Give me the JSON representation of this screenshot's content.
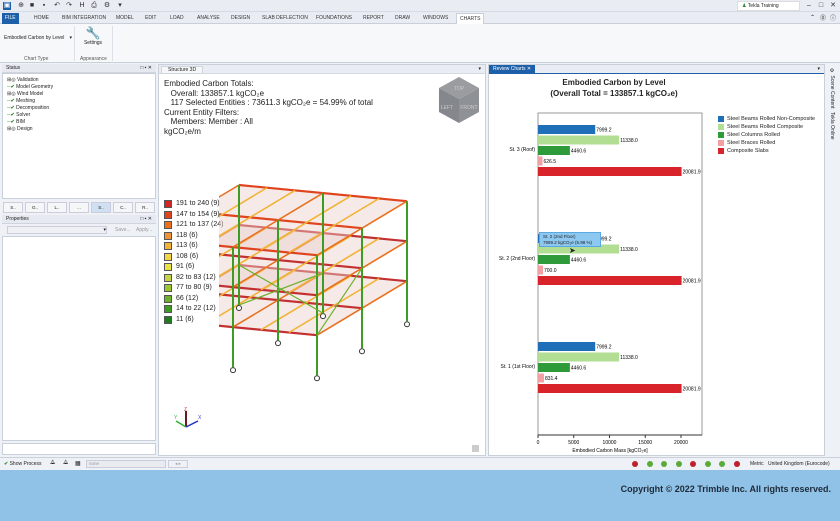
{
  "app": {
    "user": "Tekla Training"
  },
  "ribbon": {
    "tabs": [
      "FILE",
      "HOME",
      "BIM INTEGRATION",
      "MODEL",
      "EDIT",
      "LOAD",
      "ANALYSE",
      "DESIGN",
      "SLAB DEFLECTION",
      "FOUNDATIONS",
      "REPORT",
      "DRAW",
      "WINDOWS",
      "CHARTS"
    ],
    "chart_type_value": "Embodied Carbon by Level",
    "chart_type_group": "Chart Type",
    "settings_label": "Settings",
    "appearance_group": "Appearance"
  },
  "status_panel": {
    "title": "Status",
    "items": [
      {
        "label": "Validation",
        "state": "info"
      },
      {
        "label": "Model Geometry",
        "state": "ok"
      },
      {
        "label": "Wind Model",
        "state": "info"
      },
      {
        "label": "Meshing",
        "state": "ok"
      },
      {
        "label": "Decomposition",
        "state": "ok"
      },
      {
        "label": "Solver",
        "state": "ok"
      },
      {
        "label": "BIM",
        "state": "ok"
      },
      {
        "label": "Design",
        "state": "info"
      }
    ],
    "bottom_tabs": [
      "S..",
      "G..",
      "L..",
      "...",
      "S..",
      "C..",
      "R.."
    ]
  },
  "properties_panel": {
    "title": "Properties",
    "save": "Save...",
    "apply": "Apply..."
  },
  "structure3d": {
    "tab": "Structure 3D",
    "lines": [
      "Embodied Carbon Totals:",
      "   Overall: 133857.1 kgCO₂e",
      "   117 Selected Entities : 73611.3 kgCO₂e = 54.99% of total",
      "Current Entity Filters:",
      "   Members: Member : All",
      "kgCO₂e/m"
    ],
    "viewcube": [
      "TOP",
      "LEFT",
      "FRONT"
    ],
    "legend": [
      {
        "label": "191 to 240 (9)",
        "color": "#d42424"
      },
      {
        "label": "147 to 154 (9)",
        "color": "#e0441e"
      },
      {
        "label": "121 to 137 (24)",
        "color": "#e8701e"
      },
      {
        "label": "118 (6)",
        "color": "#f0923a"
      },
      {
        "label": "113 (6)",
        "color": "#f2b234"
      },
      {
        "label": "108 (6)",
        "color": "#f2d444"
      },
      {
        "label": "91 (6)",
        "color": "#e8e444"
      },
      {
        "label": "82 to 83 (12)",
        "color": "#c4d444"
      },
      {
        "label": "77 to 80 (9)",
        "color": "#9cc834"
      },
      {
        "label": "66 (12)",
        "color": "#6cb02c"
      },
      {
        "label": "14 to 22 (12)",
        "color": "#3c9c24"
      },
      {
        "label": "11 (6)",
        "color": "#1e7e1e"
      }
    ],
    "axes": [
      "X",
      "Y",
      "Z"
    ]
  },
  "review_charts": {
    "tab": "Review Charts",
    "side_tabs": [
      "Scene Content",
      "Tekla Online"
    ],
    "tooltip": {
      "line1": "St. 2 (2nd Floor)",
      "line2": "7999.2 kgCO₂e (5.98 %)"
    }
  },
  "chart_data": {
    "type": "bar",
    "orientation": "horizontal",
    "title": "Embodied Carbon by Level",
    "subtitle": "(Overall Total = 133857.1 kgCO₂e)",
    "xlabel": "Embodied Carbon Mass [kgCO₂e]",
    "xlim": [
      0,
      22000
    ],
    "xticks": [
      "0",
      "5000",
      "10000",
      "15000",
      "20000"
    ],
    "categories": [
      "St. 3 (Roof)",
      "St. 2 (2nd Floor)",
      "St. 1 (1st Floor)"
    ],
    "series": [
      {
        "name": "Steel Beams Rolled Non-Composite",
        "color": "#1f6fb8",
        "values": [
          7999.2,
          7999.2,
          7999.2
        ],
        "labels": [
          "7999.2",
          "7999.2",
          "7999.2"
        ]
      },
      {
        "name": "Steel Beams Rolled Composite",
        "color": "#b2de93",
        "values": [
          11338.0,
          11338.0,
          11338.0
        ],
        "labels": [
          "11338.0",
          "11338.0",
          "11338.0"
        ]
      },
      {
        "name": "Steel Columns Rolled",
        "color": "#2e9a3a",
        "values": [
          4460.6,
          4460.6,
          4460.6
        ],
        "labels": [
          "4460.6",
          "4460.6",
          "4460.6"
        ]
      },
      {
        "name": "Steel Braces Rolled",
        "color": "#f2a0a4",
        "values": [
          626.5,
          700.0,
          831.4
        ],
        "labels": [
          "626.5",
          "700.0",
          "831.4"
        ]
      },
      {
        "name": "Composite Slabs",
        "color": "#d8232a",
        "values": [
          20081.9,
          20081.9,
          20081.9
        ],
        "labels": [
          "20081.9",
          "20081.9",
          "20081.9"
        ]
      }
    ],
    "legend_position": "right"
  },
  "statusbar": {
    "show_process": "Show Process",
    "combo": "none",
    "units": "Metric",
    "code": "United Kingdom (Eurocode)",
    "indicators": [
      "#c0202a",
      "#5aaa3a",
      "#5aaa3a",
      "#5aaa3a",
      "#c0202a",
      "#5aaa3a",
      "#5aaa3a",
      "#c0202a"
    ]
  },
  "footer": {
    "copyright": "Copyright © 2022 Trimble Inc. All rights reserved."
  }
}
